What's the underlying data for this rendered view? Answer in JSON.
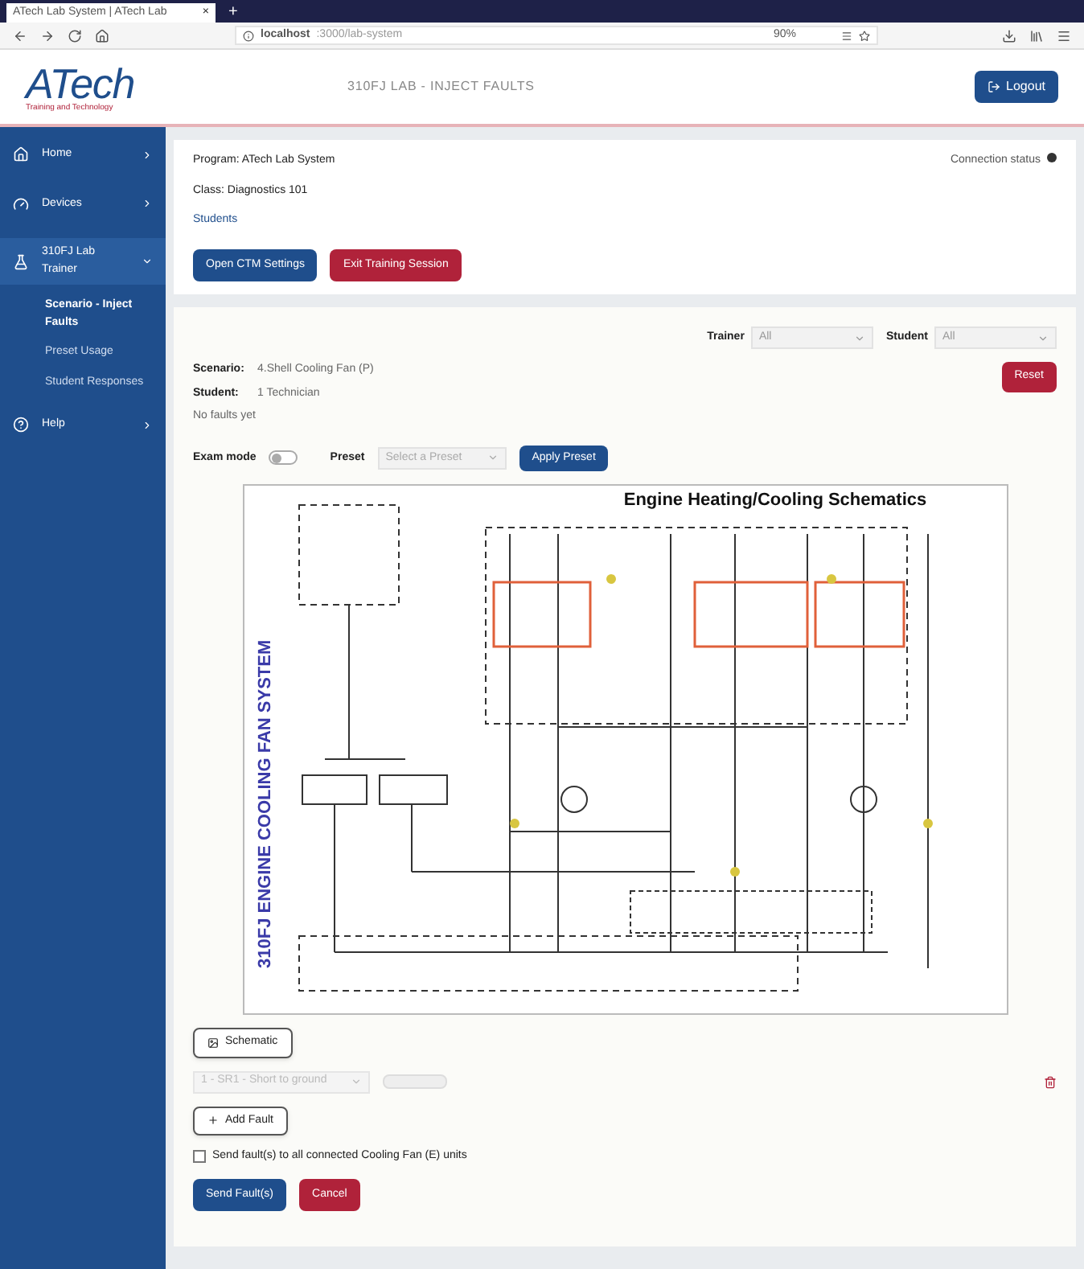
{
  "browser": {
    "tab_title": "ATech Lab System | ATech Lab",
    "tab_close": "×",
    "new_tab": "+",
    "url_host": "localhost",
    "url_path": ":3000/lab-system",
    "zoom": "90%"
  },
  "header": {
    "logo": "ATech",
    "logo_tagline": "Training and Technology",
    "title": "310FJ LAB - INJECT FAULTS",
    "logout": "Logout"
  },
  "sidebar": {
    "items": [
      {
        "label": "Home",
        "selected": false
      },
      {
        "label": "Devices",
        "selected": false
      },
      {
        "label": "310FJ Lab Trainer",
        "selected": true,
        "children": [
          {
            "label": "Scenario - Inject Faults",
            "selected": true
          },
          {
            "label": "Preset Usage",
            "selected": false
          },
          {
            "label": "Student Responses",
            "selected": false
          }
        ]
      },
      {
        "label": "Help",
        "selected": false
      }
    ]
  },
  "session": {
    "program": "Program: ATech Lab System",
    "class": "Class: Diagnostics 101",
    "students": "Students",
    "connection": "Connection status",
    "connected": true,
    "buttons": [
      {
        "label": "Open CTM Settings",
        "kind": "primary"
      },
      {
        "label": "Exit Training Session",
        "kind": "danger"
      }
    ]
  },
  "filters": [
    {
      "label": "Trainer",
      "value": "All"
    },
    {
      "label": "Student",
      "value": "All"
    }
  ],
  "scenario": {
    "scenario_label": "Scenario:",
    "scenario_value": "4.Shell Cooling Fan (P)",
    "student_label": "Student:",
    "student_value": "1 Technician",
    "status": "No faults yet",
    "reset": "Reset"
  },
  "controls": {
    "exam_mode_label": "Exam mode",
    "exam_mode": false,
    "preset_label": "Preset",
    "preset_placeholder": "Select a Preset",
    "apply": "Apply Preset"
  },
  "schematic": {
    "title": "Engine Heating/Cooling Schematics",
    "side_title": "310FJ ENGINE COOLING FAN SYSTEM"
  },
  "schematic_button": "Schematic",
  "fault": {
    "value": "1 - SR1 - Short to ground",
    "enabled": false
  },
  "add_fault": "Add Fault",
  "send_all": {
    "label": "Send fault(s) to all connected Cooling Fan (E) units",
    "checked": false
  },
  "actions": [
    {
      "label": "Send Fault(s)",
      "kind": "primary"
    },
    {
      "label": "Cancel",
      "kind": "danger"
    }
  ]
}
